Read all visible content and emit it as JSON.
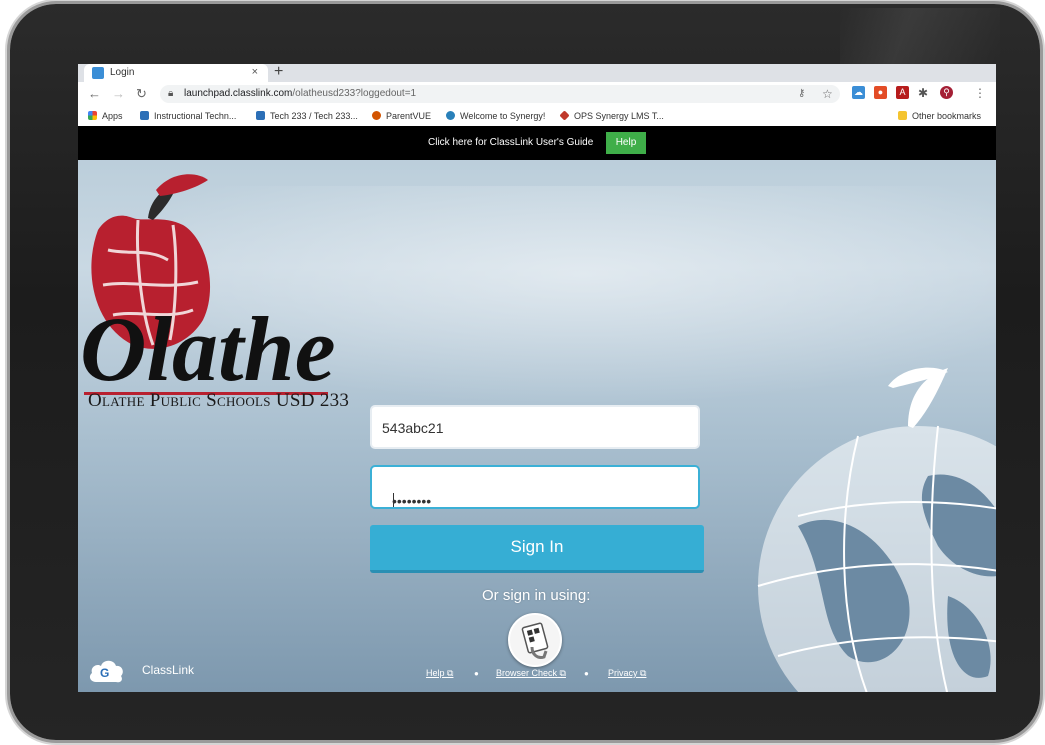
{
  "browser": {
    "tab_title": "Login",
    "tab_close": "×",
    "new_tab": "+",
    "url_host": "launchpad.classlink.com",
    "url_path": "/olatheusd233?loggedout=1",
    "bookmarks": [
      {
        "label": "Apps",
        "icon": "apps-grid-icon"
      },
      {
        "label": "Instructional Techn...",
        "icon": "olathe-icon"
      },
      {
        "label": "Tech 233 / Tech 233...",
        "icon": "olathe-icon"
      },
      {
        "label": "ParentVUE",
        "icon": "synergy-icon"
      },
      {
        "label": "Welcome to Synergy!",
        "icon": "synergy-icon"
      },
      {
        "label": "OPS Synergy LMS T...",
        "icon": "diamond-icon"
      }
    ],
    "other_bookmarks": "Other bookmarks"
  },
  "guide": {
    "text": "Click here for ClassLink User's Guide",
    "help_label": "Help"
  },
  "logo": {
    "subtitle": "Olathe Public Schools USD 233",
    "word": "Olathe"
  },
  "form": {
    "username_value": "543abc21",
    "password_value": "••••••••",
    "signin_label": "Sign In",
    "alt_label": "Or sign in using:"
  },
  "footer": {
    "brand": "ClassLink",
    "links": [
      "Help",
      "Browser Check",
      "Privacy"
    ]
  },
  "colors": {
    "help_green": "#3fae49",
    "signin_blue": "#36aed4",
    "guide_bar": "#000000"
  }
}
